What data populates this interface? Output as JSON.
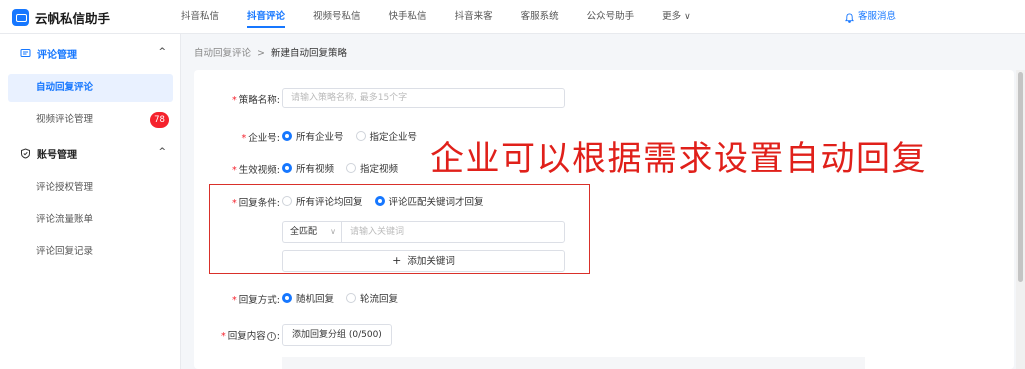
{
  "brand": {
    "name": "云帆私信助手",
    "accent": "#1677ff"
  },
  "nav": {
    "items": [
      {
        "label": "抖音私信"
      },
      {
        "label": "抖音评论"
      },
      {
        "label": "视频号私信"
      },
      {
        "label": "快手私信"
      },
      {
        "label": "抖音来客"
      },
      {
        "label": "客服系统"
      },
      {
        "label": "公众号助手"
      },
      {
        "label": "更多"
      }
    ],
    "active_index": 1,
    "support_label": "客服消息"
  },
  "sidebar": {
    "group1": {
      "title": "评论管理",
      "icon": "comment-icon",
      "items": [
        {
          "label": "自动回复评论"
        },
        {
          "label": "视频评论管理",
          "badge": "78"
        }
      ]
    },
    "group2": {
      "title": "账号管理",
      "icon": "account-icon",
      "items": [
        {
          "label": "评论授权管理"
        },
        {
          "label": "评论流量账单"
        },
        {
          "label": "评论回复记录"
        }
      ]
    }
  },
  "breadcrumb": {
    "parent": "自动回复评论",
    "separator": ">",
    "current": "新建自动回复策略"
  },
  "form": {
    "strategy_name": {
      "label": "策略名称:",
      "placeholder": "请输入策略名称, 最多15个字"
    },
    "enterprise": {
      "label": "企业号:",
      "options": [
        "所有企业号",
        "指定企业号"
      ],
      "selected": "所有企业号"
    },
    "video": {
      "label": "生效视频:",
      "options": [
        "所有视频",
        "指定视频"
      ],
      "selected": "所有视频"
    },
    "condition": {
      "label": "回复条件:",
      "options": [
        "所有评论均回复",
        "评论匹配关键词才回复"
      ],
      "selected": "评论匹配关键词才回复"
    },
    "keyword": {
      "match_mode": "全匹配",
      "placeholder": "请输入关键词",
      "add_label": "添加关键词"
    },
    "method": {
      "label": "回复方式:",
      "options": [
        "随机回复",
        "轮流回复"
      ],
      "selected": "随机回复"
    },
    "content": {
      "label_pre": "回复内容",
      "label_post": ":",
      "button": "添加回复分组 (0/500)"
    }
  },
  "overlay": {
    "text": "企业可以根据需求设置自动回复",
    "color": "#e0201a"
  }
}
